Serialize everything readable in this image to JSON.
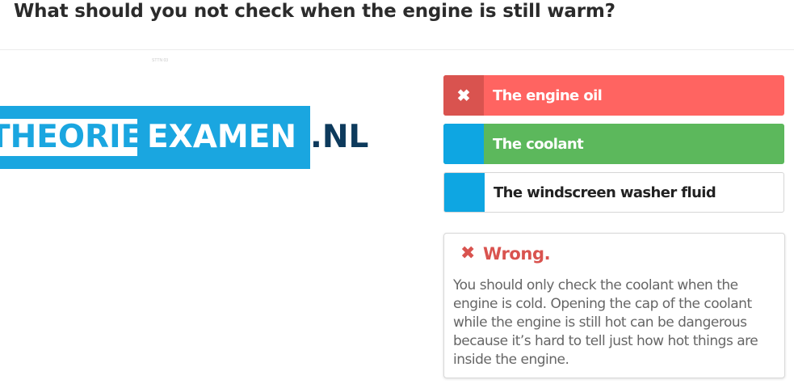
{
  "question": {
    "title": "What should you not check when the engine is still warm?"
  },
  "image": {
    "caption": "STTN 03",
    "logo": {
      "part1": "THEORIE",
      "part2": "EXAMEN",
      "tld": ".NL",
      "color": "#1aa6e0"
    }
  },
  "answers": [
    {
      "label": "The engine oil",
      "state": "wrong",
      "marker": "✖"
    },
    {
      "label": "The coolant",
      "state": "correct",
      "marker": ""
    },
    {
      "label": "The windscreen washer fluid",
      "state": "neutral",
      "marker": ""
    }
  ],
  "feedback": {
    "heading": "Wrong.",
    "icon": "x-icon",
    "icon_glyph": "✖",
    "text": "You should only check the coolant when the engine is cold. Opening the cap of the coolant while the engine is still hot can be dangerous because it’s hard to tell just how hot things are inside the engine.",
    "color": "#d9534f"
  }
}
